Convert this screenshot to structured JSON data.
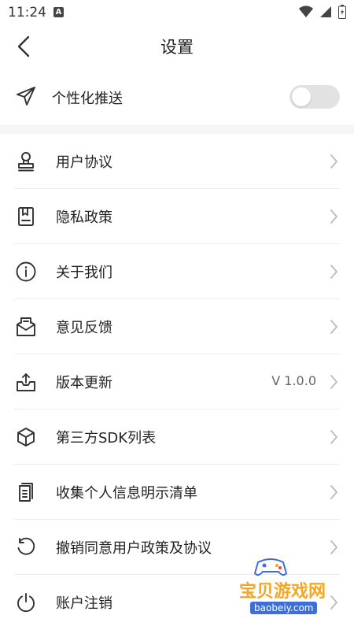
{
  "status_bar": {
    "time": "11:24",
    "notification_glyph": "A"
  },
  "header": {
    "title": "设置"
  },
  "push_setting": {
    "label": "个性化推送",
    "enabled": false,
    "icon": "paper-plane-icon"
  },
  "menu": [
    {
      "label": "用户协议",
      "icon": "user-stamp-icon",
      "value": ""
    },
    {
      "label": "隐私政策",
      "icon": "document-bookmark-icon",
      "value": ""
    },
    {
      "label": "关于我们",
      "icon": "info-circle-icon",
      "value": ""
    },
    {
      "label": "意见反馈",
      "icon": "mail-feedback-icon",
      "value": ""
    },
    {
      "label": "版本更新",
      "icon": "tray-upload-icon",
      "value": "V 1.0.0"
    },
    {
      "label": "第三方SDK列表",
      "icon": "cube-icon",
      "value": ""
    },
    {
      "label": "收集个人信息明示清单",
      "icon": "document-list-icon",
      "value": ""
    },
    {
      "label": "撤销同意用户政策及协议",
      "icon": "undo-icon",
      "value": ""
    },
    {
      "label": "账户注销",
      "icon": "power-icon",
      "value": ""
    }
  ],
  "watermark": {
    "name": "宝贝游戏网",
    "url": "baobeiy.com"
  },
  "colors": {
    "toggle_off": "#e2e2e2",
    "divider": "#ececec",
    "watermark_text": "#f5a623",
    "watermark_url_bg": "#3d6fd6"
  }
}
